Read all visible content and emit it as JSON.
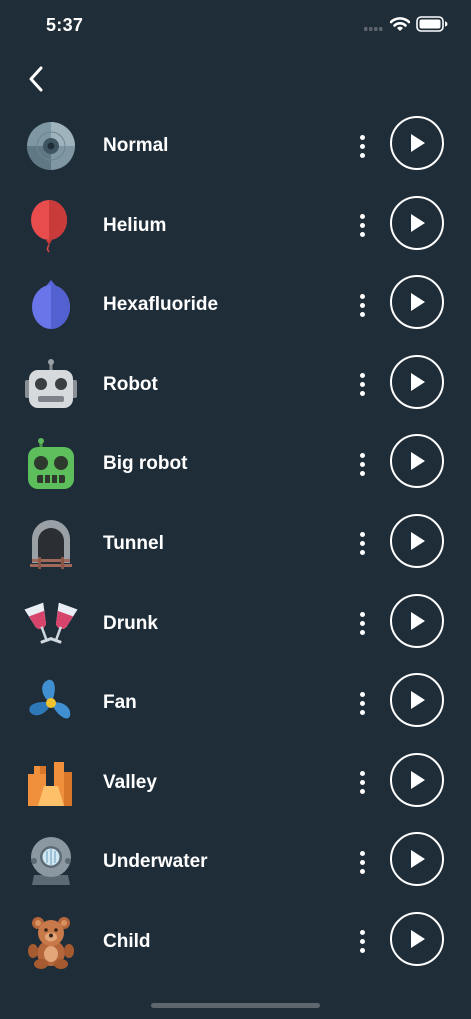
{
  "status_bar": {
    "time": "5:37"
  },
  "effects": [
    {
      "label": "Normal",
      "icon": "disc-icon"
    },
    {
      "label": "Helium",
      "icon": "red-balloon-icon"
    },
    {
      "label": "Hexafluoride",
      "icon": "blue-balloon-icon"
    },
    {
      "label": "Robot",
      "icon": "robot-icon"
    },
    {
      "label": "Big robot",
      "icon": "green-robot-icon"
    },
    {
      "label": "Tunnel",
      "icon": "tunnel-icon"
    },
    {
      "label": "Drunk",
      "icon": "wine-glasses-icon"
    },
    {
      "label": "Fan",
      "icon": "fan-icon"
    },
    {
      "label": "Valley",
      "icon": "valley-icon"
    },
    {
      "label": "Underwater",
      "icon": "diving-helmet-icon"
    },
    {
      "label": "Child",
      "icon": "teddy-bear-icon"
    }
  ],
  "colors": {
    "background": "#1f2d38",
    "foreground": "#ffffff"
  }
}
